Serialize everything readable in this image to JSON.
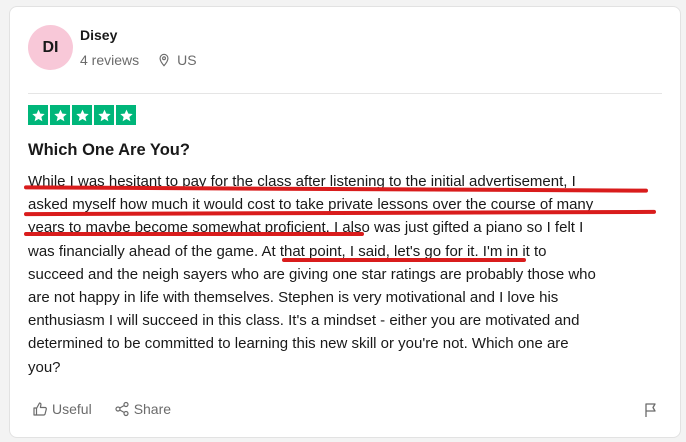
{
  "reviewer": {
    "initials": "DI",
    "name": "Disey",
    "reviews": "4 reviews",
    "country": "US",
    "avatar_color": "#f8c8d8"
  },
  "rating": {
    "stars": 5,
    "max": 5,
    "color": "#00b67a"
  },
  "review": {
    "title": "Which One Are You?",
    "lines": [
      "While I was hesitant to pay for the class after listening to the initial advertisement, I",
      "asked myself how much it would cost to take private lessons over the course of many",
      "years to maybe become somewhat proficient. I also was just gifted a piano so I felt I",
      "was financially ahead of the game. At that point, I said, let's go for it. I'm in it to",
      "succeed and the neigh sayers who are giving one star ratings are probably those who",
      "are not happy in life with themselves. Stephen is very motivational and I love his",
      "enthusiasm I will succeed in this class. It's a mindset - either you are motivated and",
      "determined to be committed to learning this new skill or you're not. Which one are",
      "you?"
    ]
  },
  "actions": {
    "useful": "Useful",
    "share": "Share",
    "flag_icon": "flag-icon"
  },
  "annotation_color": "#d91c1c"
}
